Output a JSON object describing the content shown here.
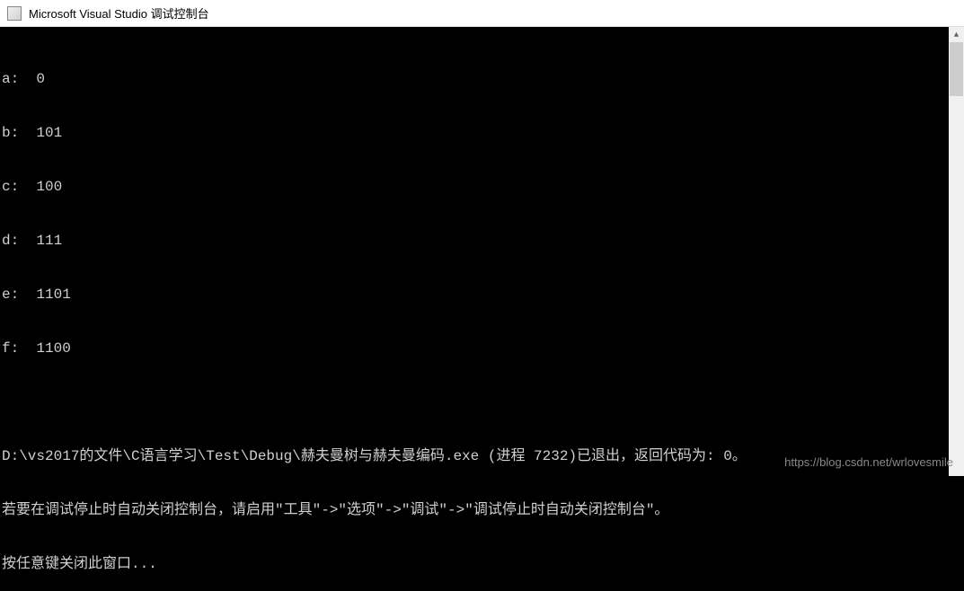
{
  "titlebar": {
    "title": "Microsoft Visual Studio 调试控制台"
  },
  "output": {
    "lines": [
      "a:  0",
      "b:  101",
      "c:  100",
      "d:  111",
      "e:  1101",
      "f:  1100"
    ],
    "exit_line": "D:\\vs2017的文件\\C语言学习\\Test\\Debug\\赫夫曼树与赫夫曼编码.exe (进程 7232)已退出，返回代码为: 0。",
    "hint_line": "若要在调试停止时自动关闭控制台，请启用\"工具\"->\"选项\"->\"调试\"->\"调试停止时自动关闭控制台\"。",
    "close_line": "按任意键关闭此窗口..."
  },
  "watermark": "https://blog.csdn.net/wrlovesmile"
}
